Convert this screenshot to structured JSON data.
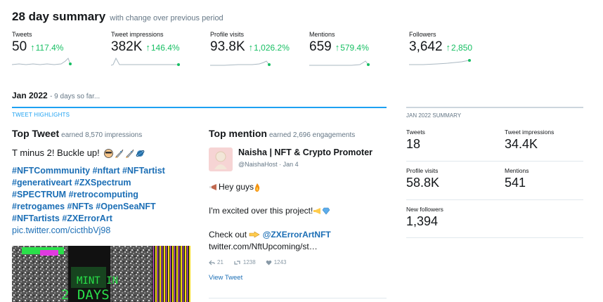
{
  "summary": {
    "title": "28 day summary",
    "subtitle": "with change over previous period"
  },
  "stats": [
    {
      "label": "Tweets",
      "value": "50",
      "change": "117.4%"
    },
    {
      "label": "Tweet impressions",
      "value": "382K",
      "change": "146.4%"
    },
    {
      "label": "Profile visits",
      "value": "93.8K",
      "change": "1,026.2%"
    },
    {
      "label": "Mentions",
      "value": "659",
      "change": "579.4%"
    },
    {
      "label": "Followers",
      "value": "3,642",
      "change": "2,850"
    }
  ],
  "month": {
    "title": "Jan 2022",
    "note": "- 9 days so far..."
  },
  "highlights": {
    "section_label": "TWEET HIGHLIGHTS"
  },
  "top_tweet": {
    "title": "Top Tweet",
    "earned": "earned 8,570 impressions",
    "text": "T minus 2! Buckle up!",
    "hashtag_lines": [
      "#NFTCommmunity #nftart #NFTartist",
      "#generativeart #ZXSpectrum",
      "#SPECTRUM #retrocomputing",
      "#retrogames #NFTs #OpenSeaNFT",
      "#NFTartists #ZXErrorArt"
    ],
    "link": "pic.twitter.com/cicthbVj98",
    "media_text_1": "MINT IN",
    "media_text_2": "2 DAYS"
  },
  "top_mention": {
    "title": "Top mention",
    "earned": "earned 2,696 engagements",
    "author_name": "Naisha | NFT & Crypto Promoter",
    "author_handle": "@NaishaHost · Jan 4",
    "line1": "Hey guys",
    "line2": "I'm excited over this project!",
    "line3_prefix": "Check out",
    "line3_mention": "@ZXErrorArtNFT",
    "link": "twitter.com/NftUpcoming/st…",
    "replies": "21",
    "retweets": "1238",
    "likes": "1243",
    "view_label": "View Tweet"
  },
  "month_summary": {
    "section_label": "JAN 2022 SUMMARY",
    "tweets_label": "Tweets",
    "tweets_value": "18",
    "impressions_label": "Tweet impressions",
    "impressions_value": "34.4K",
    "visits_label": "Profile visits",
    "visits_value": "58.8K",
    "mentions_label": "Mentions",
    "mentions_value": "541",
    "followers_label": "New followers",
    "followers_value": "1,394"
  },
  "colors": {
    "accent": "#1da1f2",
    "positive": "#17bf63",
    "link": "#1b6eb5",
    "muted": "#657786"
  }
}
